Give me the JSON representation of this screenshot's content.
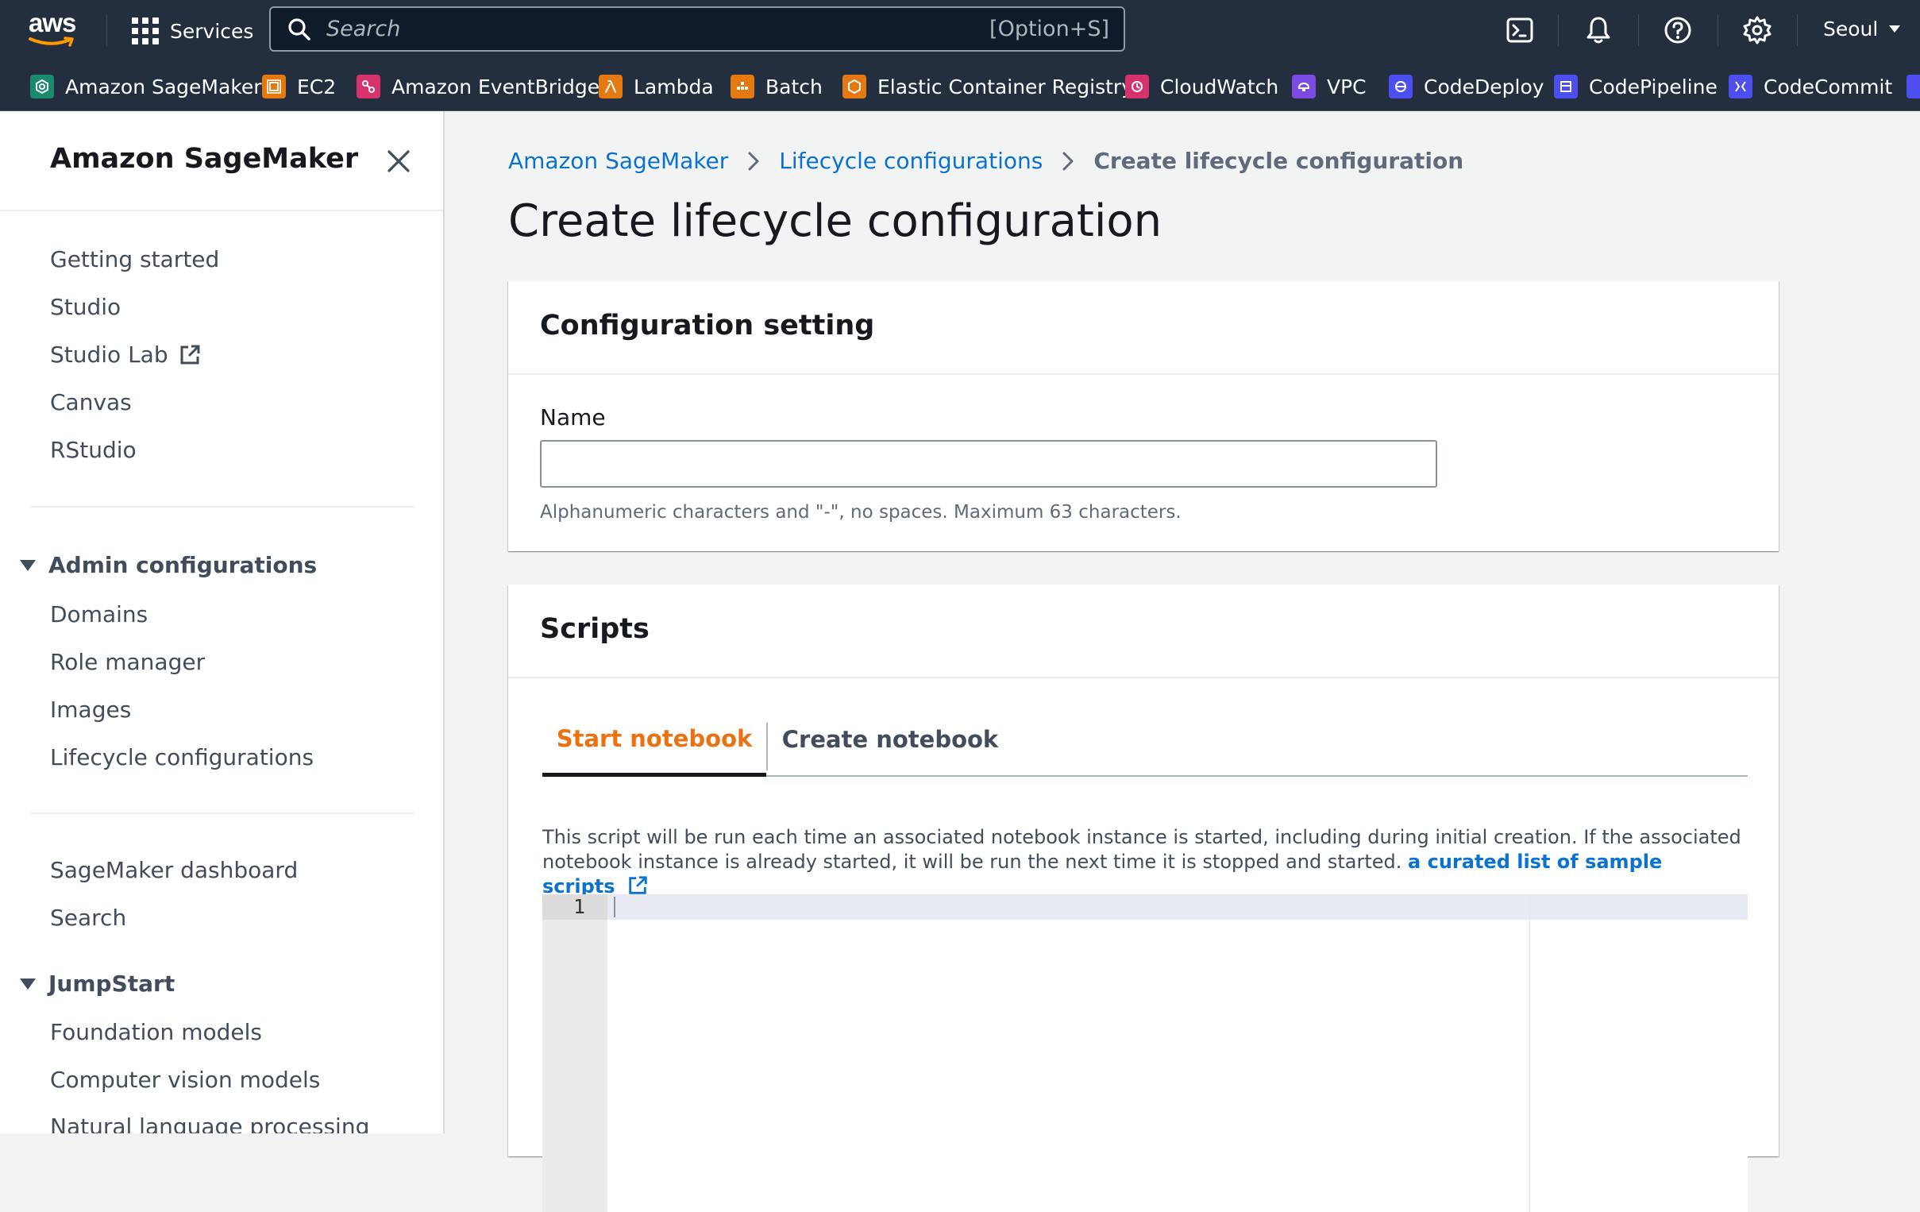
{
  "topbar": {
    "logo_text": "aws",
    "services_label": "Services",
    "search_placeholder": "Search",
    "search_shortcut": "[Option+S]",
    "region_label": "Seoul",
    "icons": [
      "cloudshell-icon",
      "bell-icon",
      "help-icon",
      "gear-icon"
    ]
  },
  "favorites": [
    {
      "label": "Amazon SageMaker",
      "icon": "sagemaker-icon",
      "color": "#1a8a6f"
    },
    {
      "label": "EC2",
      "icon": "ec2-icon",
      "color": "#e47911"
    },
    {
      "label": "Amazon EventBridge",
      "icon": "eventbridge-icon",
      "color": "#d6336c"
    },
    {
      "label": "Lambda",
      "icon": "lambda-icon",
      "color": "#e47911"
    },
    {
      "label": "Batch",
      "icon": "batch-icon",
      "color": "#e47911"
    },
    {
      "label": "Elastic Container Registry",
      "icon": "ecr-icon",
      "color": "#e47911"
    },
    {
      "label": "CloudWatch",
      "icon": "cloudwatch-icon",
      "color": "#d6336c"
    },
    {
      "label": "VPC",
      "icon": "vpc-icon",
      "color": "#7b4ae0"
    },
    {
      "label": "CodeDeploy",
      "icon": "codedeploy-icon",
      "color": "#4c4ef0"
    },
    {
      "label": "CodePipeline",
      "icon": "codepipeline-icon",
      "color": "#4c4ef0"
    },
    {
      "label": "CodeCommit",
      "icon": "codecommit-icon",
      "color": "#4c4ef0"
    }
  ],
  "sidebar": {
    "title": "Amazon SageMaker",
    "group1": [
      "Getting started",
      "Studio",
      "Studio Lab",
      "Canvas",
      "RStudio"
    ],
    "admin": {
      "title": "Admin configurations",
      "items": [
        "Domains",
        "Role manager",
        "Images",
        "Lifecycle configurations"
      ]
    },
    "group2": [
      "SageMaker dashboard",
      "Search"
    ],
    "jumpstart": {
      "title": "JumpStart",
      "items": [
        "Foundation models",
        "Computer vision models",
        "Natural language processing"
      ]
    }
  },
  "breadcrumb": [
    "Amazon SageMaker",
    "Lifecycle configurations",
    "Create lifecycle configuration"
  ],
  "page_title": "Create lifecycle configuration",
  "config_panel": {
    "title": "Configuration setting",
    "name_label": "Name",
    "name_value": "",
    "name_hint": "Alphanumeric characters and \"-\", no spaces. Maximum 63 characters."
  },
  "scripts_panel": {
    "title": "Scripts",
    "tabs": [
      "Start notebook",
      "Create notebook"
    ],
    "active_tab": "Start notebook",
    "description": "This script will be run each time an associated notebook instance is started, including during initial creation. If the associated notebook instance is already started, it will be run the next time it is stopped and started.",
    "link_text": "a curated list of sample scripts",
    "editor_line_number": "1"
  },
  "colors": {
    "nav_bg": "#232f3e",
    "link": "#0972d3",
    "active_tab": "#ec7211",
    "page_bg": "#f2f3f3"
  }
}
